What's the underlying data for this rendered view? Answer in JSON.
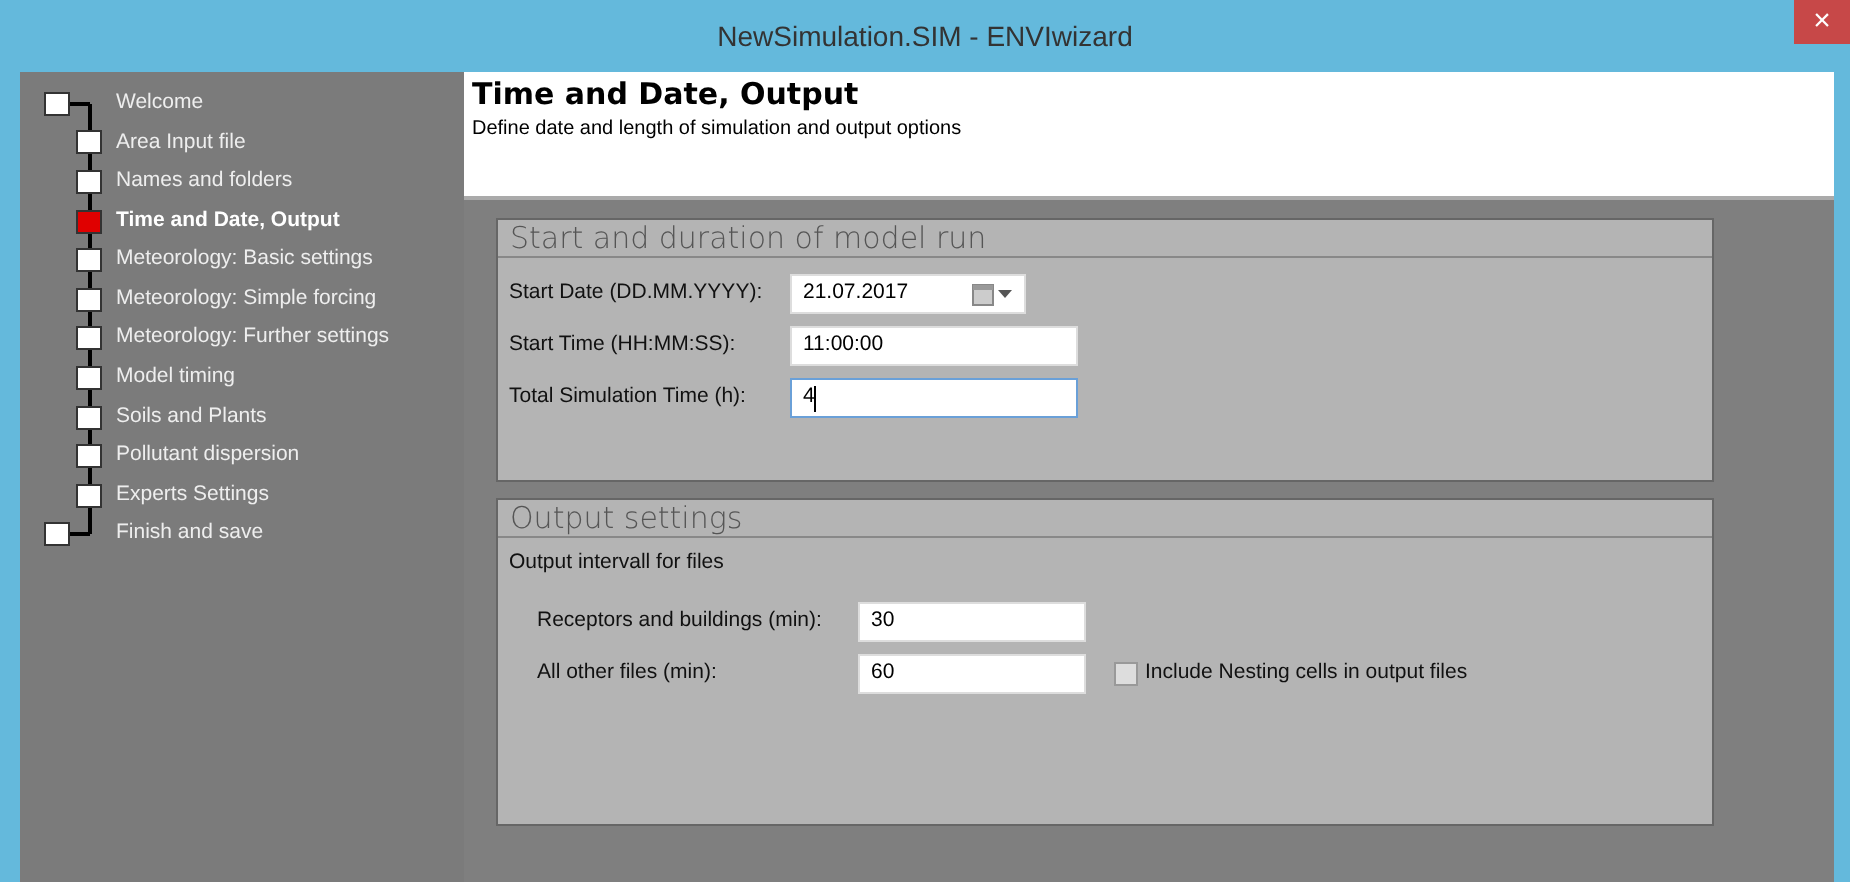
{
  "window": {
    "title": "NewSimulation.SIM - ENVIwizard",
    "close": "×"
  },
  "sidebar": {
    "items": [
      {
        "label": "Welcome",
        "kind": "root",
        "selected": false
      },
      {
        "label": "Area Input file",
        "kind": "step",
        "selected": false
      },
      {
        "label": "Names and folders",
        "kind": "step",
        "selected": false
      },
      {
        "label": "Time and Date, Output",
        "kind": "step",
        "selected": true
      },
      {
        "label": "Meteorology: Basic settings",
        "kind": "step",
        "selected": false
      },
      {
        "label": "Meteorology: Simple forcing",
        "kind": "step",
        "selected": false
      },
      {
        "label": "Meteorology: Further settings",
        "kind": "step",
        "selected": false
      },
      {
        "label": "Model timing",
        "kind": "step",
        "selected": false
      },
      {
        "label": "Soils and Plants",
        "kind": "step",
        "selected": false
      },
      {
        "label": "Pollutant dispersion",
        "kind": "step",
        "selected": false
      },
      {
        "label": "Experts Settings",
        "kind": "step",
        "selected": false
      },
      {
        "label": "Finish and save",
        "kind": "root",
        "selected": false
      }
    ]
  },
  "header": {
    "title": "Time and Date, Output",
    "subtitle": "Define date and length of simulation and output options"
  },
  "groups": [
    {
      "title": "Start and duration of model run",
      "fields": [
        {
          "label": "Start Date (DD.MM.YYYY):",
          "value": "21.07.2017",
          "kind": "date",
          "focused": false
        },
        {
          "label": "Start Time (HH:MM:SS):",
          "value": "11:00:00",
          "kind": "text",
          "focused": false
        },
        {
          "label": "Total Simulation Time (h):",
          "value": "4",
          "kind": "text",
          "focused": true
        }
      ]
    },
    {
      "title": "Output settings",
      "subheading": "Output intervall for files",
      "fields": [
        {
          "label": "Receptors  and buildings (min):",
          "value": "30",
          "kind": "text",
          "focused": false
        },
        {
          "label": "All other files (min):",
          "value": "60",
          "kind": "text",
          "focused": false,
          "checkbox": {
            "label": "Include Nesting cells in output files",
            "checked": false
          }
        }
      ]
    }
  ]
}
